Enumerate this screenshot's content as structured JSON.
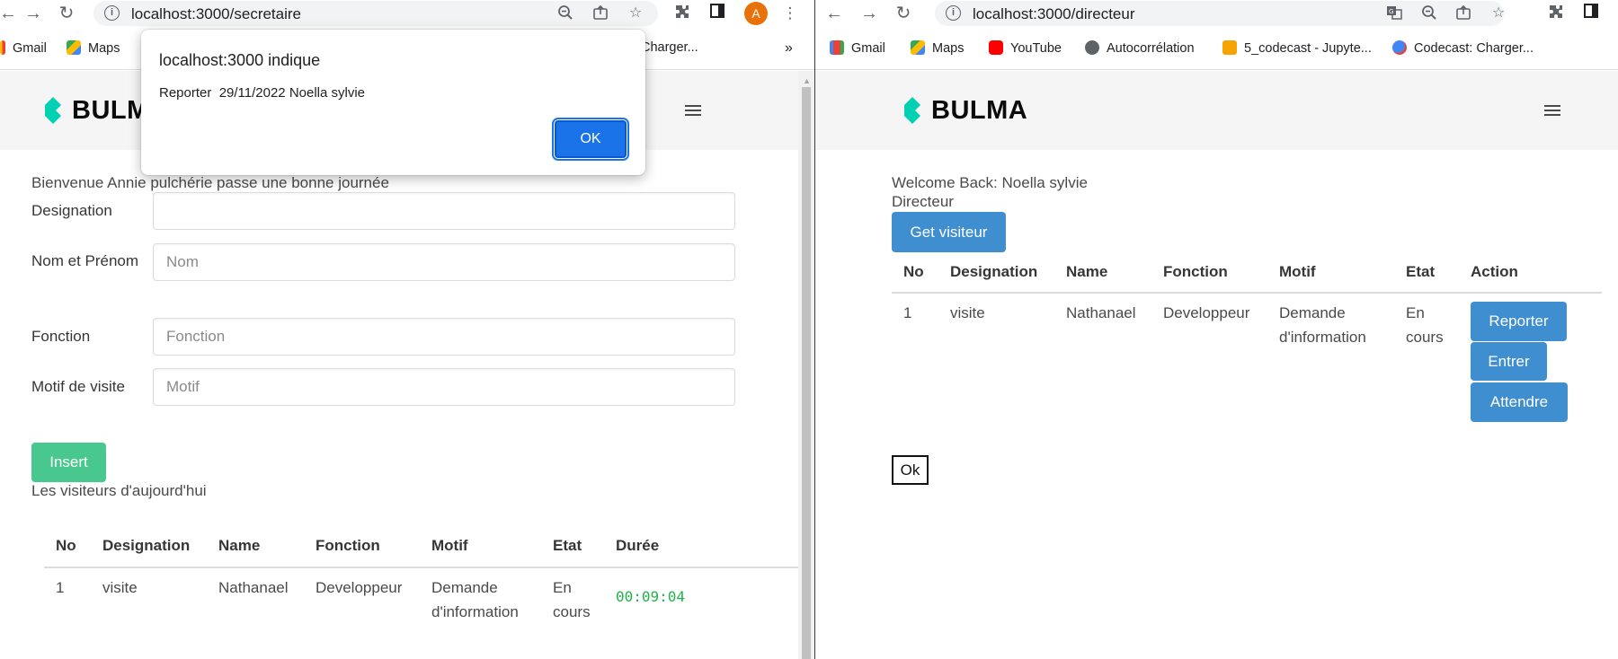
{
  "left": {
    "url": "localhost:3000/secretaire",
    "avatar_letter": "A",
    "bookmarks": [
      "Gmail",
      "Maps",
      "Charger...",
      "»"
    ],
    "brand": "BULMA",
    "welcome": "Bienvenue Annie pulchérie passe une bonne journée",
    "form": {
      "designation_label": "Designation",
      "nom_label": "Nom et Prénom",
      "nom_placeholder": "Nom",
      "fonction_label": "Fonction",
      "fonction_placeholder": "Fonction",
      "motif_label": "Motif de visite",
      "motif_placeholder": "Motif"
    },
    "insert_label": "Insert",
    "visitors_title": "Les visiteurs d'aujourd'hui",
    "table": {
      "headers": [
        "No",
        "Designation",
        "Name",
        "Fonction",
        "Motif",
        "Etat",
        "Durée"
      ],
      "rows": [
        {
          "no": "1",
          "designation": "visite",
          "name": "Nathanael",
          "fonction": "Developpeur",
          "motif": "Demande d'information",
          "etat": "En cours",
          "duree": "00:09:04"
        }
      ]
    },
    "dialog": {
      "title": "localhost:3000 indique",
      "message": "Reporter  29/11/2022 Noella sylvie",
      "ok_label": "OK"
    }
  },
  "right": {
    "url": "localhost:3000/directeur",
    "bookmarks": [
      "Gmail",
      "Maps",
      "YouTube",
      "Autocorrélation",
      "5_codecast - Jupyte...",
      "Codecast: Charger..."
    ],
    "brand": "BULMA",
    "welcome": "Welcome Back: Noella sylvie",
    "role": "Directeur",
    "get_visitors_label": "Get visiteur",
    "table": {
      "headers": [
        "No",
        "Designation",
        "Name",
        "Fonction",
        "Motif",
        "Etat",
        "Action"
      ],
      "rows": [
        {
          "no": "1",
          "designation": "visite",
          "name": "Nathanael",
          "fonction": "Developpeur",
          "motif": "Demande d'information",
          "etat": "En cours"
        }
      ]
    },
    "actions": [
      "Reporter",
      "Entrer",
      "Attendre"
    ],
    "ok_label": "Ok"
  },
  "colors": {
    "bulma_primary": "#00d1b2",
    "bulma_success": "#48c78e",
    "bulma_info": "#3e8ed0",
    "timer": "#22b14c",
    "dialog_ok": "#1a73e8"
  }
}
